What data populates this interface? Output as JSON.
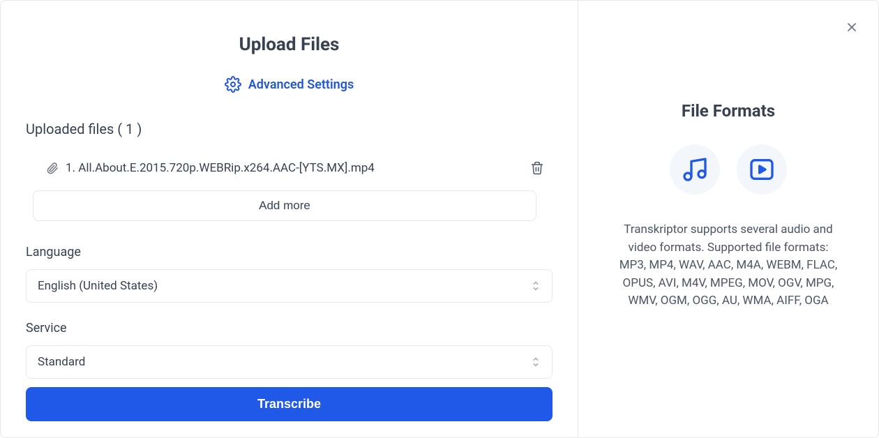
{
  "left": {
    "title": "Upload Files",
    "advanced_settings_label": "Advanced Settings",
    "uploaded_files_label": "Uploaded files ( 1 )",
    "file_name": "1. All.About.E.2015.720p.WEBRip.x264.AAC-[YTS.MX].mp4",
    "add_more_label": "Add more",
    "language_label": "Language",
    "language_selected": "English (United States)",
    "service_label": "Service",
    "service_selected": "Standard",
    "transcribe_label": "Transcribe"
  },
  "right": {
    "title": "File Formats",
    "description": "Transkriptor supports several audio and video formats. Supported file formats: MP3, MP4, WAV, AAC, M4A, WEBM, FLAC, OPUS, AVI, M4V, MPEG, MOV, OGV, MPG, WMV, OGM, OGG, AU, WMA, AIFF, OGA"
  },
  "colors": {
    "accent": "#2058e8",
    "link": "#2058d4",
    "text": "#374151"
  }
}
